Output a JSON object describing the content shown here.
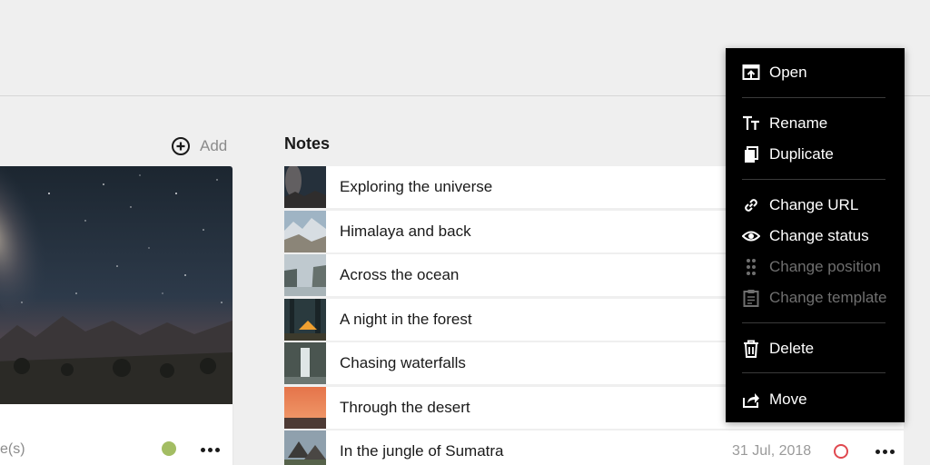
{
  "gallery": {
    "add_label": "Add",
    "card_count_text": "e(s)",
    "card_status_color": "#a3bd63"
  },
  "notes": {
    "title": "Notes",
    "items": [
      {
        "title": "Exploring the universe",
        "thumb": "night-sky"
      },
      {
        "title": "Himalaya and back",
        "thumb": "mountains"
      },
      {
        "title": "Across the ocean",
        "thumb": "ocean-cliffs"
      },
      {
        "title": "A night in the forest",
        "thumb": "tent-forest"
      },
      {
        "title": "Chasing waterfalls",
        "thumb": "waterfall"
      },
      {
        "title": "Through the desert",
        "thumb": "desert-sunset"
      },
      {
        "title": "In the jungle of Sumatra",
        "thumb": "jungle-huts",
        "date": "31 Jul, 2018",
        "status_color": "#e0484f"
      }
    ]
  },
  "context_menu": {
    "open": "Open",
    "rename": "Rename",
    "duplicate": "Duplicate",
    "change_url": "Change URL",
    "change_status": "Change status",
    "change_position": "Change position",
    "change_template": "Change template",
    "delete": "Delete",
    "move": "Move"
  },
  "icons": {
    "add": "plus-circle-icon",
    "open": "open-window-icon",
    "rename": "text-size-icon",
    "duplicate": "duplicate-icon",
    "change_url": "link-icon",
    "change_status": "eye-icon",
    "change_position": "drag-handle-icon",
    "change_template": "template-icon",
    "delete": "trash-icon",
    "move": "move-share-icon",
    "more": "more-horizontal-icon"
  }
}
